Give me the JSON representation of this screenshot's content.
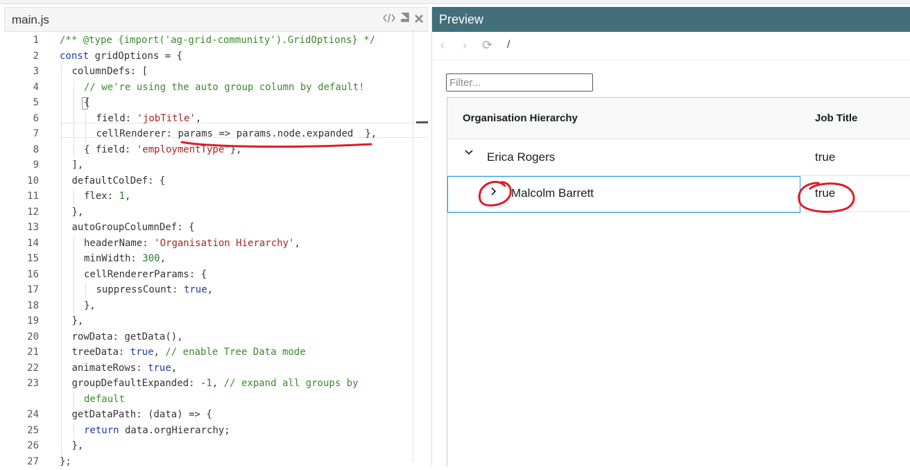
{
  "editor": {
    "file_name": "main.js",
    "icons": [
      "code-icon",
      "book-icon",
      "close-icon"
    ],
    "lines": [
      {
        "n": "1",
        "indent": 0,
        "tokens": [
          {
            "c": "cmt",
            "t": "/** @type {import('ag-grid-community').GridOptions} */"
          }
        ]
      },
      {
        "n": "2",
        "indent": 0,
        "tokens": [
          {
            "c": "kw",
            "t": "const"
          },
          {
            "c": "",
            "t": " gridOptions = {"
          }
        ]
      },
      {
        "n": "3",
        "indent": 1,
        "tokens": [
          {
            "c": "",
            "t": "columnDefs: ["
          }
        ]
      },
      {
        "n": "4",
        "indent": 2,
        "tokens": [
          {
            "c": "cmt",
            "t": "// we're using the auto group column by default!"
          }
        ]
      },
      {
        "n": "5",
        "indent": 2,
        "tokens": [
          {
            "c": "",
            "t": "{"
          }
        ]
      },
      {
        "n": "6",
        "indent": 3,
        "tokens": [
          {
            "c": "",
            "t": "field: "
          },
          {
            "c": "str",
            "t": "'jobTitle'"
          },
          {
            "c": "",
            "t": ","
          }
        ]
      },
      {
        "n": "7",
        "indent": 3,
        "tokens": [
          {
            "c": "",
            "t": "cellRenderer: params => params.node.expanded  },"
          }
        ]
      },
      {
        "n": "8",
        "indent": 2,
        "tokens": [
          {
            "c": "",
            "t": "{ field: "
          },
          {
            "c": "str",
            "t": "'employmentType'"
          },
          {
            "c": "",
            "t": "},"
          }
        ]
      },
      {
        "n": "9",
        "indent": 1,
        "tokens": [
          {
            "c": "",
            "t": "],"
          }
        ]
      },
      {
        "n": "10",
        "indent": 1,
        "tokens": [
          {
            "c": "",
            "t": "defaultColDef: {"
          }
        ]
      },
      {
        "n": "11",
        "indent": 2,
        "tokens": [
          {
            "c": "",
            "t": "flex: "
          },
          {
            "c": "num",
            "t": "1"
          },
          {
            "c": "",
            "t": ","
          }
        ]
      },
      {
        "n": "12",
        "indent": 1,
        "tokens": [
          {
            "c": "",
            "t": "},"
          }
        ]
      },
      {
        "n": "13",
        "indent": 1,
        "tokens": [
          {
            "c": "",
            "t": "autoGroupColumnDef: {"
          }
        ]
      },
      {
        "n": "14",
        "indent": 2,
        "tokens": [
          {
            "c": "",
            "t": "headerName: "
          },
          {
            "c": "str",
            "t": "'Organisation Hierarchy'"
          },
          {
            "c": "",
            "t": ","
          }
        ]
      },
      {
        "n": "15",
        "indent": 2,
        "tokens": [
          {
            "c": "",
            "t": "minWidth: "
          },
          {
            "c": "num",
            "t": "300"
          },
          {
            "c": "",
            "t": ","
          }
        ]
      },
      {
        "n": "16",
        "indent": 2,
        "tokens": [
          {
            "c": "",
            "t": "cellRendererParams: {"
          }
        ]
      },
      {
        "n": "17",
        "indent": 3,
        "tokens": [
          {
            "c": "",
            "t": "suppressCount: "
          },
          {
            "c": "kw",
            "t": "true"
          },
          {
            "c": "",
            "t": ","
          }
        ]
      },
      {
        "n": "18",
        "indent": 2,
        "tokens": [
          {
            "c": "",
            "t": "},"
          }
        ]
      },
      {
        "n": "19",
        "indent": 1,
        "tokens": [
          {
            "c": "",
            "t": "},"
          }
        ]
      },
      {
        "n": "20",
        "indent": 1,
        "tokens": [
          {
            "c": "",
            "t": "rowData: getData(),"
          }
        ]
      },
      {
        "n": "21",
        "indent": 1,
        "tokens": [
          {
            "c": "",
            "t": "treeData: "
          },
          {
            "c": "kw",
            "t": "true"
          },
          {
            "c": "",
            "t": ", "
          },
          {
            "c": "cmt",
            "t": "// enable Tree Data mode"
          }
        ]
      },
      {
        "n": "22",
        "indent": 1,
        "tokens": [
          {
            "c": "",
            "t": "animateRows: "
          },
          {
            "c": "kw",
            "t": "true"
          },
          {
            "c": "",
            "t": ","
          }
        ]
      },
      {
        "n": "23",
        "indent": 1,
        "tokens": [
          {
            "c": "",
            "t": "groupDefaultExpanded: -"
          },
          {
            "c": "num",
            "t": "1"
          },
          {
            "c": "",
            "t": ", "
          },
          {
            "c": "cmt",
            "t": "// expand all groups by"
          }
        ]
      },
      {
        "n": "",
        "indent": 2,
        "tokens": [
          {
            "c": "cmt",
            "t": "default"
          }
        ]
      },
      {
        "n": "24",
        "indent": 1,
        "tokens": [
          {
            "c": "",
            "t": "getDataPath: (data) => {"
          }
        ]
      },
      {
        "n": "25",
        "indent": 2,
        "tokens": [
          {
            "c": "kw",
            "t": "return"
          },
          {
            "c": "",
            "t": " data.orgHierarchy;"
          }
        ]
      },
      {
        "n": "26",
        "indent": 1,
        "tokens": [
          {
            "c": "",
            "t": "},"
          }
        ]
      },
      {
        "n": "27",
        "indent": 0,
        "tokens": [
          {
            "c": "",
            "t": "};"
          }
        ]
      }
    ]
  },
  "preview": {
    "title": "Preview",
    "nav": {
      "back": "‹",
      "forward": "›",
      "refresh": "⟳",
      "path": "/"
    },
    "filter_placeholder": "Filter...",
    "columns": [
      "Organisation Hierarchy",
      "Job Title"
    ],
    "rows": [
      {
        "name": "Erica Rogers",
        "job": "true",
        "expander": "chevron-down-icon",
        "glyph": "⌄"
      },
      {
        "name": "Malcolm Barrett",
        "job": "true",
        "expander": "chevron-right-icon",
        "glyph": "›"
      }
    ]
  },
  "colors": {
    "preview_header": "#436e7b",
    "focus": "#2196f3",
    "annotation": "#e01b24"
  }
}
